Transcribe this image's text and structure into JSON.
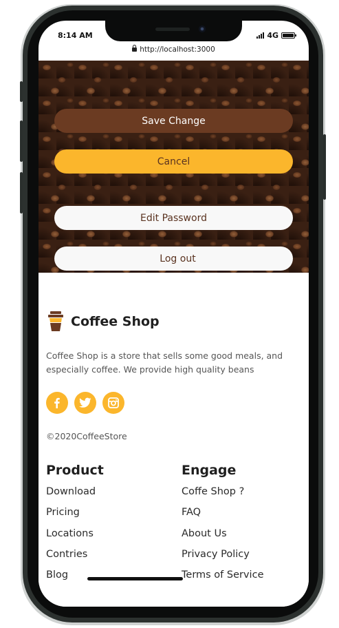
{
  "status_bar": {
    "time": "8:14 AM",
    "network": "4G"
  },
  "browser": {
    "url": "http://localhost:3000"
  },
  "actions": {
    "save_label": "Save Change",
    "cancel_label": "Cancel",
    "edit_password_label": "Edit Password",
    "logout_label": "Log out"
  },
  "footer": {
    "brand_name": "Coffee Shop",
    "description": "Coffee Shop is a store that sells some good meals, and especially coffee. We provide high quality beans",
    "socials": [
      "facebook-icon",
      "twitter-icon",
      "instagram-icon"
    ],
    "copyright": "©2020CoffeeStore",
    "product": {
      "title": "Product",
      "links": [
        "Download",
        "Pricing",
        "Locations",
        "Contries",
        "Blog"
      ]
    },
    "engage": {
      "title": "Engage",
      "links": [
        "Coffe Shop ?",
        "FAQ",
        "About Us",
        "Privacy Policy",
        "Terms of Service"
      ]
    }
  },
  "colors": {
    "accent": "#fbb62c",
    "brand_brown": "#6b3b22",
    "button_light": "#f8f8f8"
  }
}
